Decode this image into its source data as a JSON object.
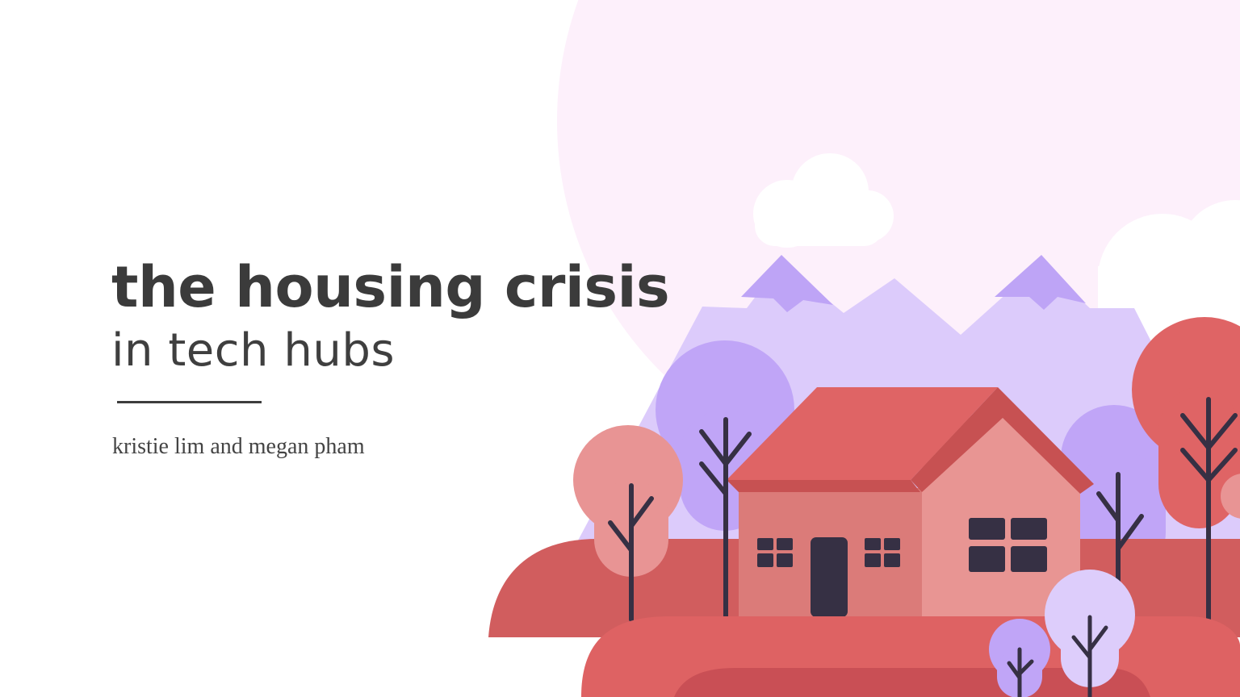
{
  "slide": {
    "title": "the housing crisis",
    "subtitle": "in tech hubs",
    "authors": "kristie lim and megan pham"
  },
  "colors": {
    "background": "#ffffff",
    "title_text": "#3b3b3b",
    "subtitle_text": "#3f3f3f",
    "divider": "#3d3d3d",
    "author_text": "#444444",
    "sky_glow": "#fdf0fb",
    "cloud": "#ffffff",
    "mountain": "#dccbfb",
    "mountain_peak": "#bea4f6",
    "hill_dark": "#d15d5e",
    "hill_front": "#de6263",
    "hill_inner": "#c94f55",
    "roof": "#df6465",
    "roof_shade": "#c75152",
    "house_left_wall": "#db7b79",
    "house_right_wall": "#e89593",
    "window_door": "#363044",
    "tree_pink": "#e89494",
    "tree_purple": "#c0a5f7",
    "tree_lilac": "#ddcdfb",
    "tree_red": "#df6465",
    "trunk": "#363044"
  },
  "icons": [
    "cloud-icon",
    "mountain-icon",
    "house-icon",
    "tree-icon"
  ]
}
